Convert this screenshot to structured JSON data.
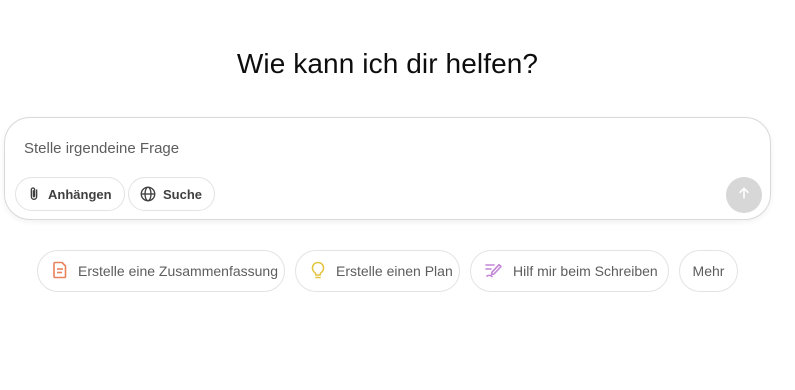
{
  "heading": "Wie kann ich dir helfen?",
  "composer": {
    "placeholder": "Stelle irgendeine Frage",
    "attach_label": "Anhängen",
    "search_label": "Suche"
  },
  "suggestions": [
    {
      "label": "Erstelle eine Zusammenfassung",
      "icon": "document-icon",
      "color": "#e9825a"
    },
    {
      "label": "Erstelle einen Plan",
      "icon": "lightbulb-icon",
      "color": "#e2c541"
    },
    {
      "label": "Hilf mir beim Schreiben",
      "icon": "pen-icon",
      "color": "#c285d6"
    },
    {
      "label": "Mehr"
    }
  ]
}
